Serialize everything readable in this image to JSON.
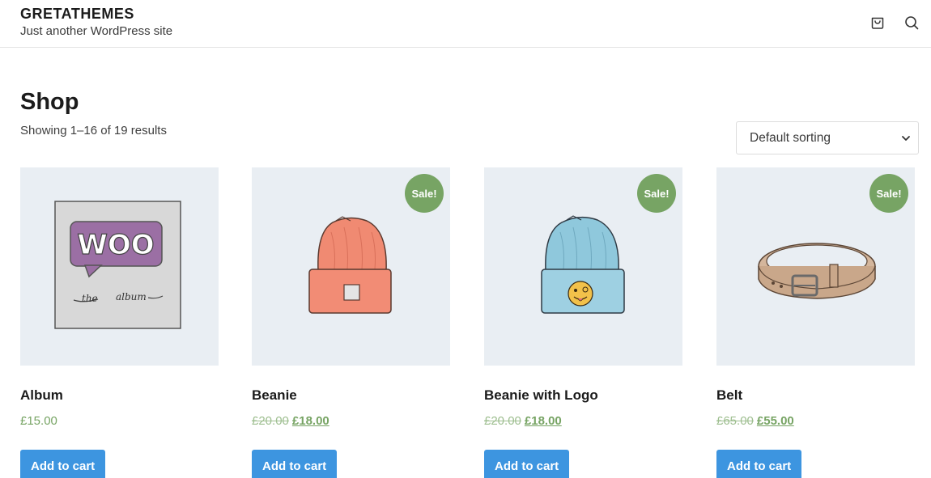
{
  "header": {
    "site_title": "GRETATHEMES",
    "site_description": "Just another WordPress site",
    "icons": [
      "cart-icon",
      "search-icon"
    ]
  },
  "shop": {
    "title": "Shop",
    "result_count": "Showing 1–16 of 19 results",
    "sorting": {
      "selected": "Default sorting"
    }
  },
  "products": [
    {
      "name": "Album",
      "price": "£15.00",
      "regular_price": "",
      "sale_price": "",
      "on_sale": false,
      "badge": "",
      "button": "Add to cart",
      "image": "woo-album"
    },
    {
      "name": "Beanie",
      "price": "",
      "regular_price": "£20.00",
      "sale_price": "£18.00",
      "on_sale": true,
      "badge": "Sale!",
      "button": "Add to cart",
      "image": "orange-beanie"
    },
    {
      "name": "Beanie with Logo",
      "price": "",
      "regular_price": "£20.00",
      "sale_price": "£18.00",
      "on_sale": true,
      "badge": "Sale!",
      "button": "Add to cart",
      "image": "blue-beanie-with-logo"
    },
    {
      "name": "Belt",
      "price": "",
      "regular_price": "£65.00",
      "sale_price": "£55.00",
      "on_sale": true,
      "badge": "Sale!",
      "button": "Add to cart",
      "image": "leather-belt"
    }
  ],
  "colors": {
    "accent_button": "#3d95e0",
    "sale_badge": "#77a464",
    "price": "#77a464",
    "thumb_bg": "#e9eef3"
  }
}
